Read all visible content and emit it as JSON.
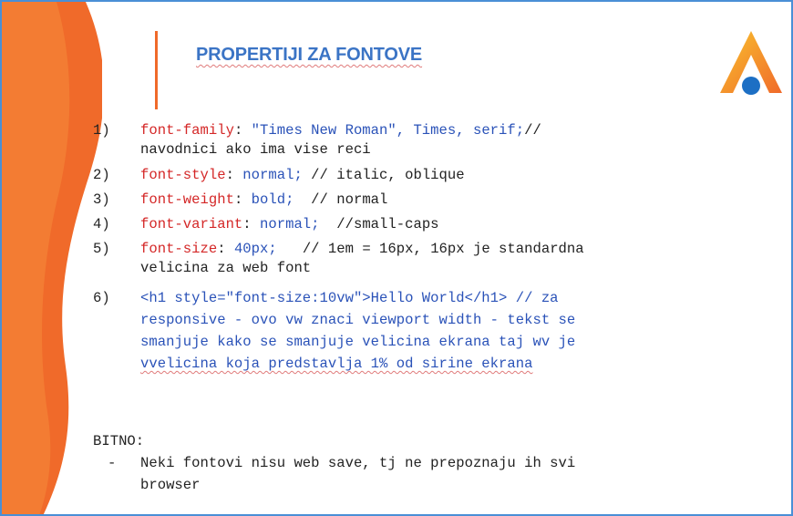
{
  "slide": {
    "title": "PROPERTIJI ZA FONTOVE",
    "logo_icon": "stylized-A-logo-icon",
    "colors": {
      "accent_orange": "#f06a2a",
      "title_blue": "#3b74c5",
      "property_red": "#d42727",
      "value_blue": "#2a52b8"
    }
  },
  "items": [
    {
      "num": "1)",
      "prop": "font-family",
      "sep": ": ",
      "value": "\"Times New Roman\", Times, serif;",
      "comment": "//",
      "cont": "navodnici ako ima vise reci"
    },
    {
      "num": "2)",
      "prop": "font-style",
      "sep": ": ",
      "value": "normal;",
      "comment": " // italic, oblique"
    },
    {
      "num": "3)",
      "prop": "font-weight",
      "sep": ": ",
      "value": "bold;",
      "comment": "  // normal"
    },
    {
      "num": "4)",
      "prop": "font-variant",
      "sep": ": ",
      "value": "normal;",
      "comment": "  //small-caps"
    },
    {
      "num": "5)",
      "prop": "font-size",
      "sep": ": ",
      "value": "40px;",
      "comment": "   // 1em = 16px, 16px je standardna",
      "cont": "velicina za web font"
    },
    {
      "num": "6)",
      "lines": [
        "<h1 style=\"font-size:10vw\">Hello World</h1> // za",
        "responsive - ovo vw znaci viewport width - tekst se",
        "smanjuje kako se smanjuje velicina ekrana taj wv je",
        "vvelicina koja predstavlja 1% od sirine ekrana"
      ]
    }
  ],
  "bitno": {
    "heading": "BITNO:",
    "bullet": "-",
    "line1": "Neki fontovi nisu web save, tj ne prepoznaju ih svi",
    "line2": "browser"
  }
}
